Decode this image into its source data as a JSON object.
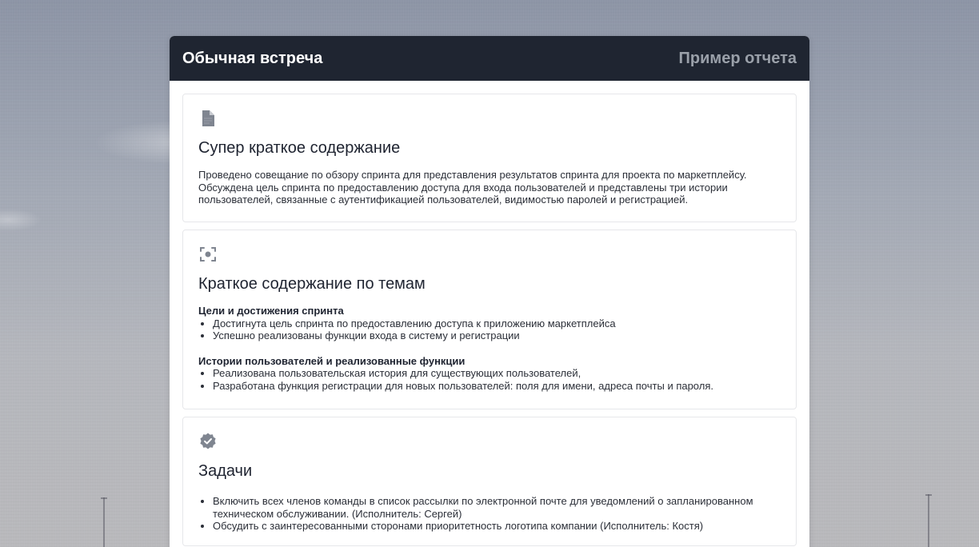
{
  "header": {
    "title": "Обычная встреча",
    "sample_label": "Пример отчета"
  },
  "colors": {
    "header_bg": "#1f2531",
    "icon": "#7f8590",
    "sample_label": "#9aa0a9"
  },
  "cards": [
    {
      "icon": "document-icon",
      "title": "Супер краткое содержание",
      "text": "Проведено совещание по обзору спринта для представления результатов спринта для проекта по маркетплейсу. Обсуждена цель спринта по предоставлению доступа для входа пользователей и представлены три истории пользователей, связанные с аутентификацией пользователей, видимостью паролей и регистрацией."
    },
    {
      "icon": "focus-icon",
      "title": "Краткое содержание по темам",
      "sections": [
        {
          "heading": "Цели и достижения спринта",
          "items": [
            "Достигнута цель спринта по предоставлению доступа к приложению маркетплейса",
            "Успешно реализованы функции входа в систему и регистрации"
          ]
        },
        {
          "heading": "Истории пользователей и реализованные функции",
          "items": [
            "Реализована пользовательская история для существующих пользователей,",
            "Разработана функция регистрации для новых пользователей: поля для имени, адреса почты и пароля."
          ]
        }
      ]
    },
    {
      "icon": "check-badge-icon",
      "title": "Задачи",
      "items": [
        "Включить всех членов команды в список рассылки по электронной почте для уведомлений о запланированном техническом обслуживании. (Исполнитель: Сергей)",
        "Обсудить с заинтересованными сторонами приоритетность логотипа компании (Исполнитель: Костя)"
      ]
    }
  ]
}
